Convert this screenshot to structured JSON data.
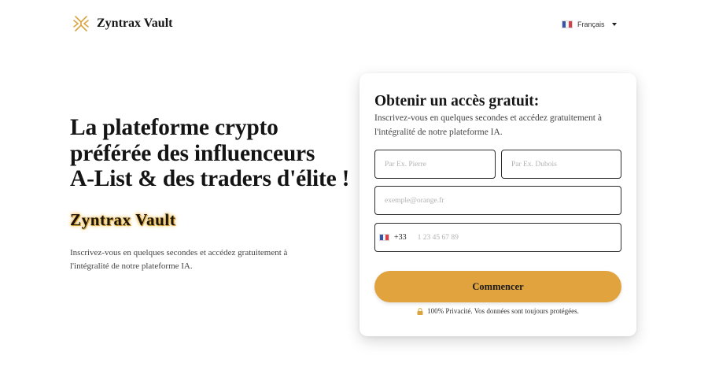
{
  "header": {
    "brand": "Zyntrax Vault",
    "language": "Français"
  },
  "hero": {
    "title_line1": "La plateforme crypto",
    "title_line2": "préférée des influenceurs",
    "title_line3": "A-List & des traders d'élite !",
    "brand": "Zyntrax Vault",
    "description": "Inscrivez-vous en quelques secondes et accédez gratuitement à l'intégralité de notre plateforme IA."
  },
  "form": {
    "title": "Obtenir un accès gratuit:",
    "subtitle": "Inscrivez-vous en quelques secondes et accédez gratuitement à l'intégralité de notre plateforme IA.",
    "first_name_placeholder": "Par Ex. Pierre",
    "last_name_placeholder": "Par Ex. Dubois",
    "email_placeholder": "exemple@orange.fr",
    "phone_prefix": "+33",
    "phone_placeholder": "1 23 45 67 89",
    "submit_label": "Commencer",
    "privacy_text": "100% Privacité. Vos données sont toujours protégées."
  },
  "icons": {
    "logo": "logo-icon",
    "flag": "france-flag-icon",
    "caret": "chevron-down-icon",
    "lock": "lock-icon"
  },
  "colors": {
    "accent": "#e0a33e",
    "text": "#161616"
  }
}
